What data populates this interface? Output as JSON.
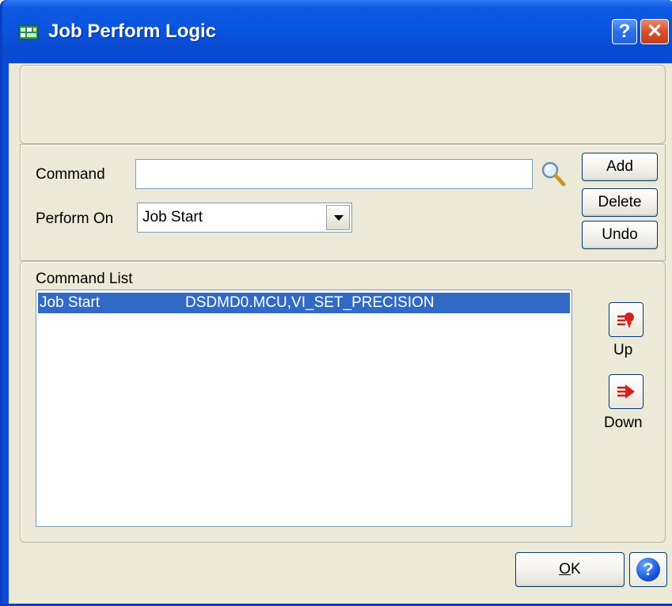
{
  "window": {
    "title": "Job Perform Logic",
    "help_glyph": "?",
    "close_glyph": "✕"
  },
  "form": {
    "command_label": "Command",
    "command_value": "",
    "perform_on_label": "Perform On",
    "perform_on_value": "Job Start"
  },
  "buttons": {
    "add": "Add",
    "delete": "Delete",
    "undo": "Undo",
    "ok_mnemonic": "O",
    "ok_rest": "K",
    "help_glyph": "?"
  },
  "command_list": {
    "label": "Command List",
    "rows": [
      {
        "trigger": "Job Start",
        "command": "DSDMD0.MCU,VI_SET_PRECISION",
        "selected": true
      }
    ]
  },
  "move": {
    "up_label": "Up",
    "down_label": "Down"
  },
  "icons": {
    "app": "app-window-icon",
    "lookup": "magnifier-icon",
    "up": "arrow-up-icon",
    "down": "arrow-down-icon"
  },
  "colors": {
    "titlebar": "#0a55de",
    "selection": "#316ac5",
    "face": "#ece9d8"
  }
}
